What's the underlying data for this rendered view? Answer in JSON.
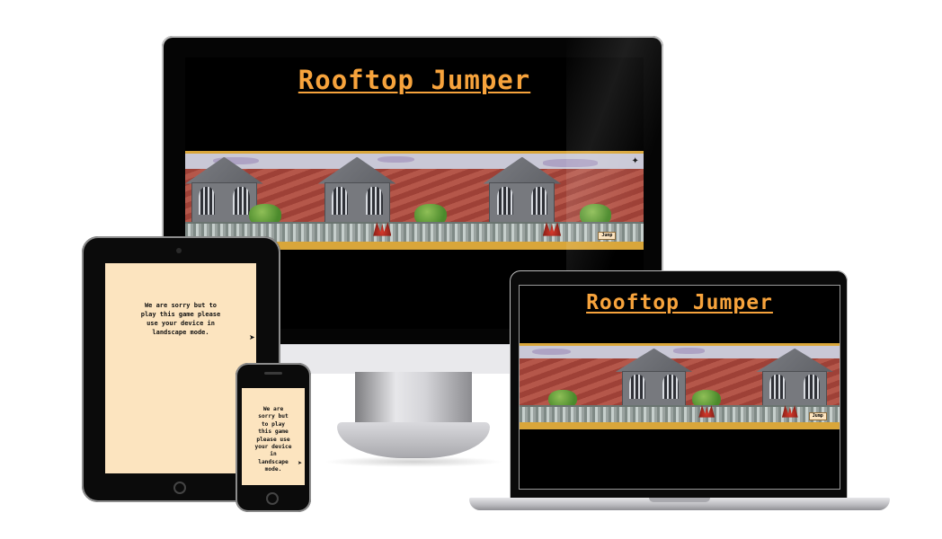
{
  "game": {
    "title": "Rooftop Jumper",
    "jump_label": "Jump",
    "sorry_message": "We are sorry but to play this game please use your device in landscape mode."
  },
  "icons": {
    "bird": "bird-icon",
    "cursor": "cursor-icon"
  },
  "colors": {
    "title": "#f7a33c",
    "screen_background": "#000000",
    "portrait_background": "#fce4bf",
    "roof_tile": "#a8473c",
    "rail": "#9aa3a0",
    "floor": "#d9a63a"
  }
}
